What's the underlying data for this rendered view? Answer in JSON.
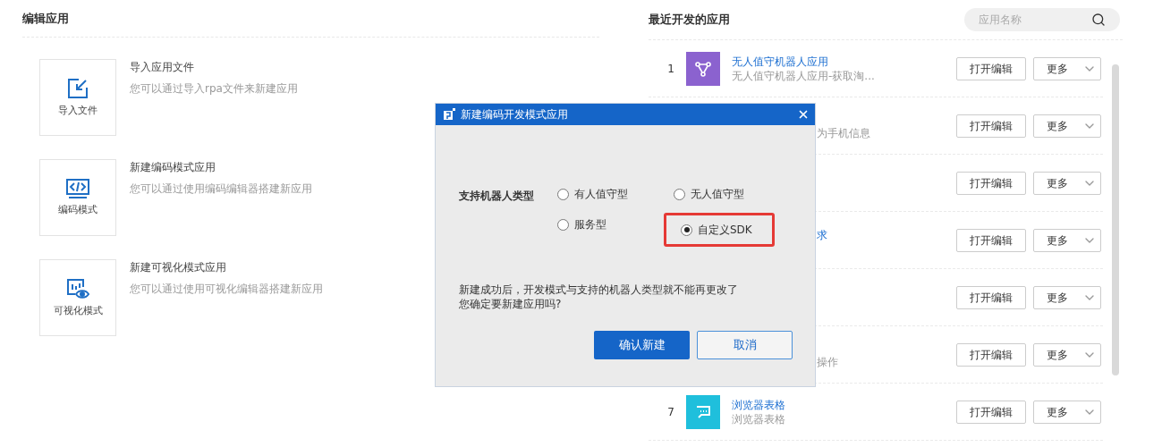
{
  "edit_apps": {
    "title": "编辑应用",
    "options": [
      {
        "icon_label": "导入文件",
        "title": "导入应用文件",
        "description": "您可以通过导入rpa文件来新建应用"
      },
      {
        "icon_label": "编码模式",
        "title": "新建编码模式应用",
        "description": "您可以通过使用编码编辑器搭建新应用"
      },
      {
        "icon_label": "可视化模式",
        "title": "新建可视化模式应用",
        "description": "您可以通过使用可视化编辑器搭建新应用"
      }
    ]
  },
  "recent_apps": {
    "title": "最近开发的应用",
    "search": {
      "placeholder": "应用名称"
    },
    "rows": [
      {
        "kind": "visible",
        "index": "1",
        "color": "#8b62cf",
        "title": "无人值守机器人应用",
        "subtitle": "无人值守机器人应用-获取淘...",
        "buttons": [
          "打开编辑",
          "更多"
        ]
      },
      {
        "kind": "covered",
        "subtitle": "为手机信息",
        "buttons": [
          "打开编辑",
          "更多"
        ]
      },
      {
        "kind": "covered",
        "buttons": [
          "打开编辑",
          "更多"
        ]
      },
      {
        "kind": "covered",
        "title": "求",
        "buttons": [
          "打开编辑",
          "更多"
        ]
      },
      {
        "kind": "covered",
        "buttons": [
          "打开编辑",
          "更多"
        ]
      },
      {
        "kind": "covered",
        "subtitle": "操作",
        "buttons": [
          "打开编辑",
          "更多"
        ]
      },
      {
        "kind": "visible",
        "index": "7",
        "color": "#1fbfdc",
        "title": "浏览器表格",
        "subtitle": "浏览器表格",
        "buttons": [
          "打开编辑",
          "更多"
        ]
      }
    ]
  },
  "dialog": {
    "title": "新建编码开发模式应用",
    "field_label": "支持机器人类型",
    "options": [
      {
        "label": "有人值守型",
        "selected": false,
        "highlighted": false
      },
      {
        "label": "无人值守型",
        "selected": false,
        "highlighted": false
      },
      {
        "label": "服务型",
        "selected": false,
        "highlighted": false
      },
      {
        "label": "自定义SDK",
        "selected": true,
        "highlighted": true
      }
    ],
    "message": [
      "新建成功后，开发模式与支持的机器人类型就不能再更改了",
      "您确定要新建应用吗?"
    ],
    "buttons": [
      {
        "kind": "primary",
        "label": "确认新建"
      },
      {
        "kind": "secondary",
        "label": "取消"
      }
    ]
  }
}
